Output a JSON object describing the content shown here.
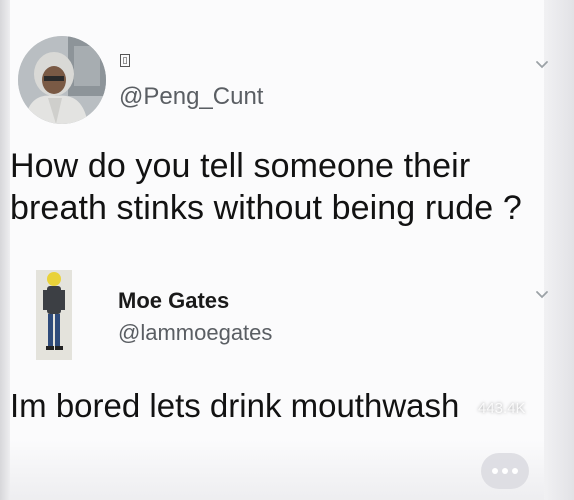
{
  "tweet1": {
    "display_name_glyph": "▯",
    "handle": "@Peng_Cunt",
    "text_line1": "How do you tell someone their",
    "text_line2": "breath stinks without being rude ?"
  },
  "tweet2": {
    "display_name": "Moe Gates",
    "handle": "@lammoegates",
    "text": "Im bored lets drink mouthwash"
  },
  "overlay": {
    "views": "443.4K",
    "more_icon": "more-dots-icon"
  }
}
